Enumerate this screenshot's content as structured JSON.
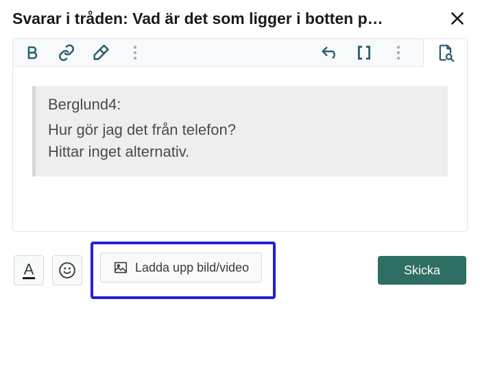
{
  "header": {
    "title": "Svarar i tråden: Vad är det som ligger i botten p…"
  },
  "quote": {
    "author": "Berglund4:",
    "line1": "Hur gör jag det från telefon?",
    "line2": "Hittar inget alternativ."
  },
  "footer": {
    "format_label": "A",
    "upload_label": "Ladda upp bild/video",
    "submit_label": "Skicka"
  }
}
